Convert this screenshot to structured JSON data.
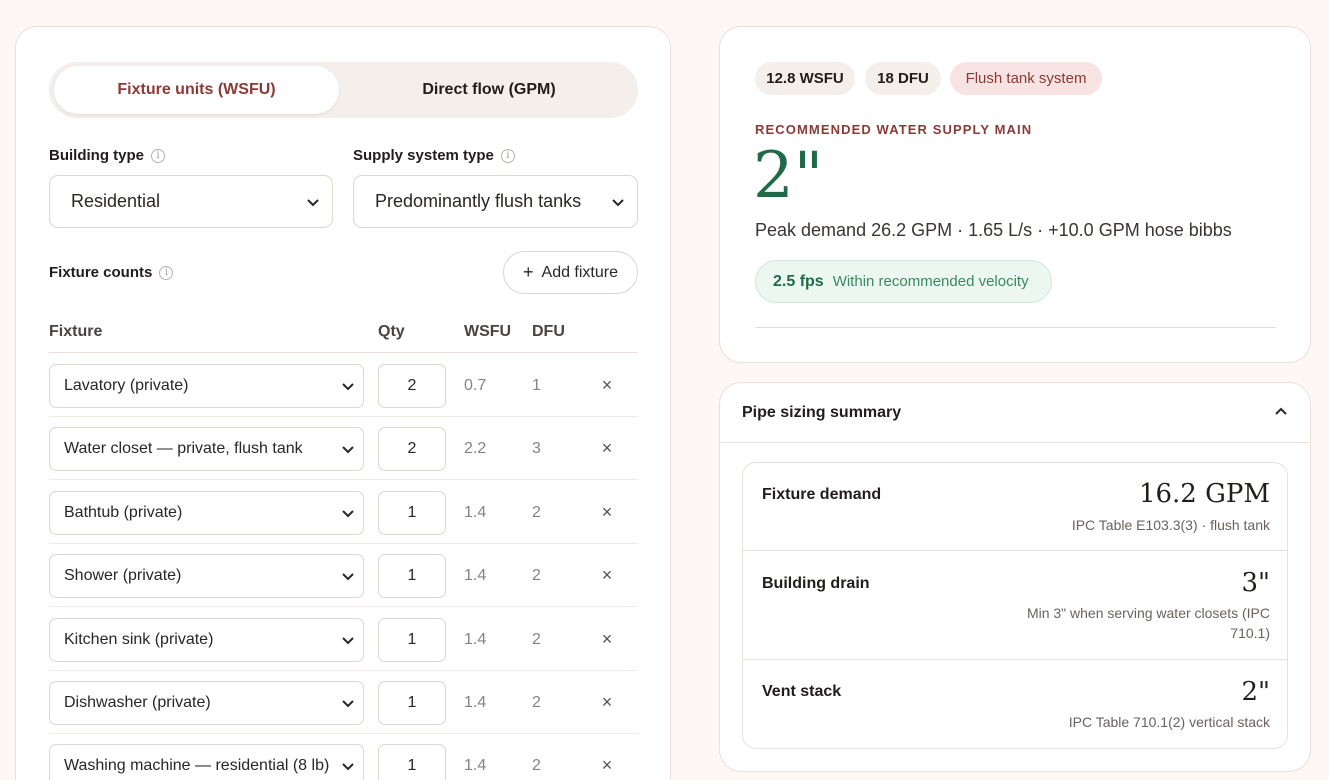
{
  "tabs": [
    {
      "label": "Fixture units (WSFU)",
      "active": true
    },
    {
      "label": "Direct flow (GPM)",
      "active": false
    }
  ],
  "building_type": {
    "label": "Building type",
    "value": "Residential"
  },
  "supply_system_type": {
    "label": "Supply system type",
    "value": "Predominantly flush tanks"
  },
  "fixture_counts": {
    "label": "Fixture counts",
    "add_button": "Add fixture",
    "columns": {
      "fixture": "Fixture",
      "qty": "Qty",
      "wsfu": "WSFU",
      "dfu": "DFU"
    },
    "rows": [
      {
        "fixture": "Lavatory (private)",
        "qty": "2",
        "wsfu": "0.7",
        "dfu": "1"
      },
      {
        "fixture": "Water closet — private, flush tank",
        "qty": "2",
        "wsfu": "2.2",
        "dfu": "3"
      },
      {
        "fixture": "Bathtub (private)",
        "qty": "1",
        "wsfu": "1.4",
        "dfu": "2"
      },
      {
        "fixture": "Shower (private)",
        "qty": "1",
        "wsfu": "1.4",
        "dfu": "2"
      },
      {
        "fixture": "Kitchen sink (private)",
        "qty": "1",
        "wsfu": "1.4",
        "dfu": "2"
      },
      {
        "fixture": "Dishwasher (private)",
        "qty": "1",
        "wsfu": "1.4",
        "dfu": "2"
      },
      {
        "fixture": "Washing machine — residential (8 lb)",
        "qty": "1",
        "wsfu": "1.4",
        "dfu": "2"
      }
    ]
  },
  "result": {
    "pills": [
      "12.8 WSFU",
      "18 DFU",
      "Flush tank system"
    ],
    "recommended_label": "RECOMMENDED WATER SUPPLY MAIN",
    "size": "2\"",
    "peak_text": "Peak demand 26.2 GPM · 1.65 L/s · +10.0 GPM hose bibbs",
    "velocity_value": "2.5 fps",
    "velocity_text": "Within recommended velocity"
  },
  "summary": {
    "title": "Pipe sizing summary",
    "rows": [
      {
        "label": "Fixture demand",
        "value": "16.2 GPM",
        "note": "IPC Table E103.3(3) · flush tank"
      },
      {
        "label": "Building drain",
        "value": "3\"",
        "note": "Min 3\" when serving water closets (IPC 710.1)"
      },
      {
        "label": "Vent stack",
        "value": "2\"",
        "note": "IPC Table 710.1(2) vertical stack"
      }
    ]
  },
  "colors": {
    "accent": "#8c3a36",
    "green": "#1f6b48",
    "background": "#fdf8f5"
  },
  "icons": {
    "info": "info-icon",
    "chevron": "chevron-down-icon",
    "remove": "close-icon",
    "collapse": "chevron-up-icon",
    "add": "plus-icon"
  }
}
